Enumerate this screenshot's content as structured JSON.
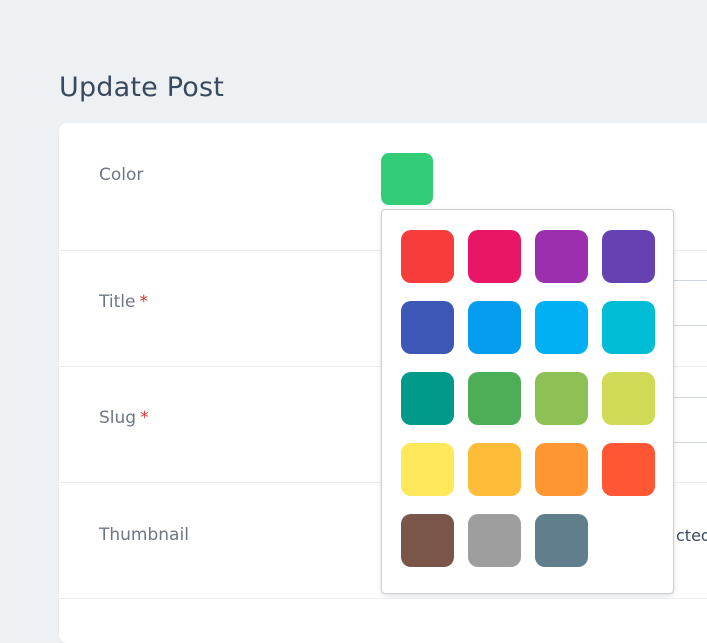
{
  "page": {
    "title": "Update Post"
  },
  "form": {
    "color_label": "Color",
    "selected_color": "#33cc77",
    "title_label": "Title",
    "slug_label": "Slug",
    "required_marker": "*",
    "thumbnail_label": "Thumbnail",
    "thumbnail_status_fragment": "cted"
  },
  "picker": {
    "swatches": [
      "#f73c3c",
      "#e91565",
      "#9b2fae",
      "#6541b2",
      "#3c57b5",
      "#049cef",
      "#00b0f2",
      "#00bcd4",
      "#00998a",
      "#4eae57",
      "#8dc156",
      "#cfdb56",
      "#ffe85c",
      "#ffbc39",
      "#ff9632",
      "#ff5734",
      "#7a554a",
      "#9e9e9e",
      "#607e8b"
    ]
  }
}
